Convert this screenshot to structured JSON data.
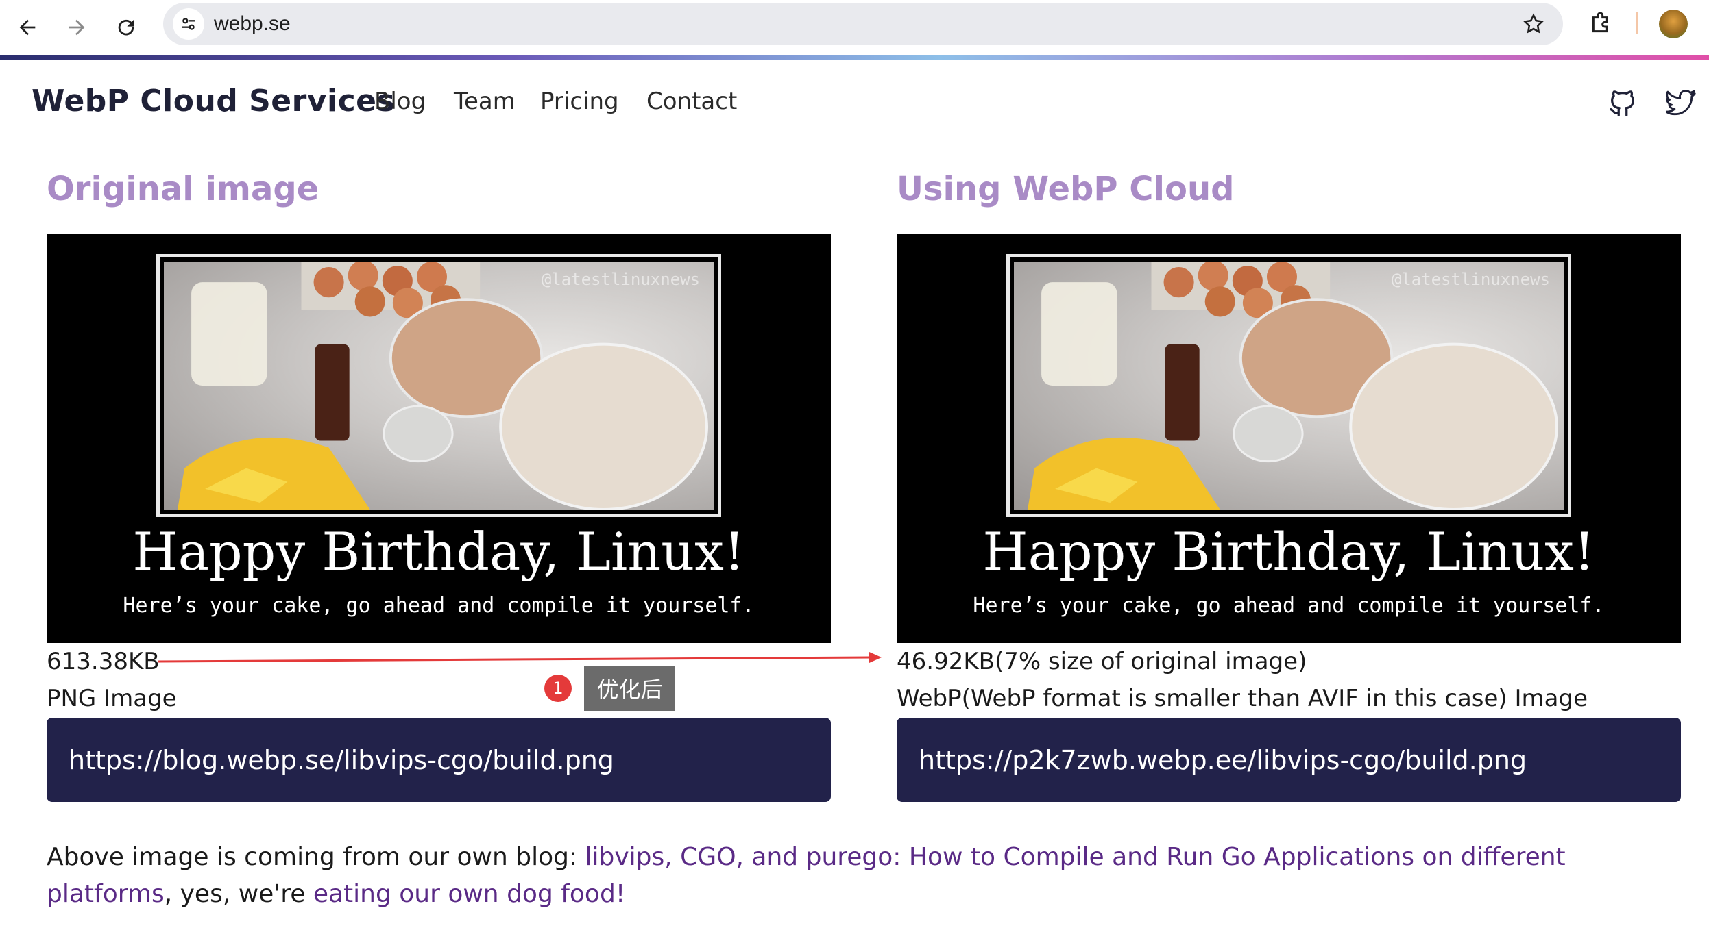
{
  "browser": {
    "url": "webp.se",
    "back_icon": "back-arrow-icon",
    "forward_icon": "forward-arrow-icon",
    "reload_icon": "reload-icon"
  },
  "site": {
    "brand": "WebP Cloud Services",
    "nav": [
      "Blog",
      "Team",
      "Pricing",
      "Contact"
    ]
  },
  "original": {
    "heading": "Original image",
    "size": "613.38KB",
    "format": "PNG Image",
    "url": "https://blog.webp.se/libvips-cgo/build.png"
  },
  "optimized": {
    "heading": "Using WebP Cloud",
    "size": "46.92KB(7% size of original image)",
    "format": "WebP(WebP format is smaller than AVIF in this case) Image",
    "url": "https://p2k7zwb.webp.ee/libvips-cgo/build.png"
  },
  "image_content": {
    "watermark": "@latestlinuxnews",
    "title": "Happy Birthday, Linux!",
    "subtitle": "Here’s your cake, go ahead and compile it yourself."
  },
  "annotation": {
    "badge_number": "1",
    "label": "优化后",
    "arrow_color": "#e43a3a"
  },
  "footer": {
    "prefix": "Above image is coming from our own blog: ",
    "link1": "libvips, CGO, and purego: How to Compile and Run Go Applications on different platforms",
    "middle": ", yes, we're ",
    "link2": "eating our own dog food!"
  },
  "colors": {
    "heading": "#a98bc6",
    "url_box": "#22224a",
    "link": "#5a2a86"
  }
}
